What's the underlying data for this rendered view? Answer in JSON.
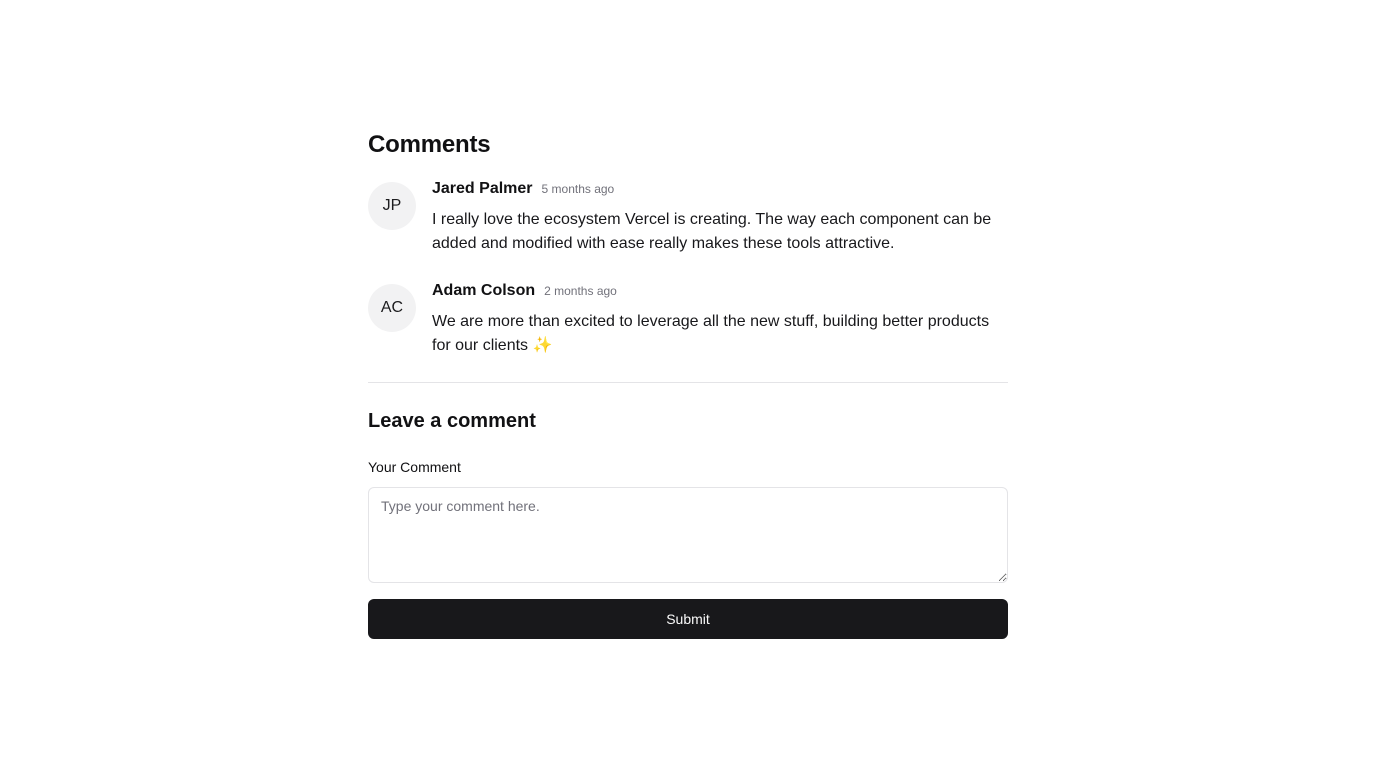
{
  "comments_section": {
    "title": "Comments",
    "comments": [
      {
        "initials": "JP",
        "author": "Jared Palmer",
        "time": "5 months ago",
        "text": "I really love the ecosystem Vercel is creating. The way each component can be added and modified with ease really makes these tools attractive."
      },
      {
        "initials": "AC",
        "author": "Adam Colson",
        "time": "2 months ago",
        "text": "We are more than excited to leverage all the new stuff, building better products for our clients ✨"
      }
    ]
  },
  "form": {
    "title": "Leave a comment",
    "label": "Your Comment",
    "placeholder": "Type your comment here.",
    "value": "",
    "submit_label": "Submit"
  }
}
